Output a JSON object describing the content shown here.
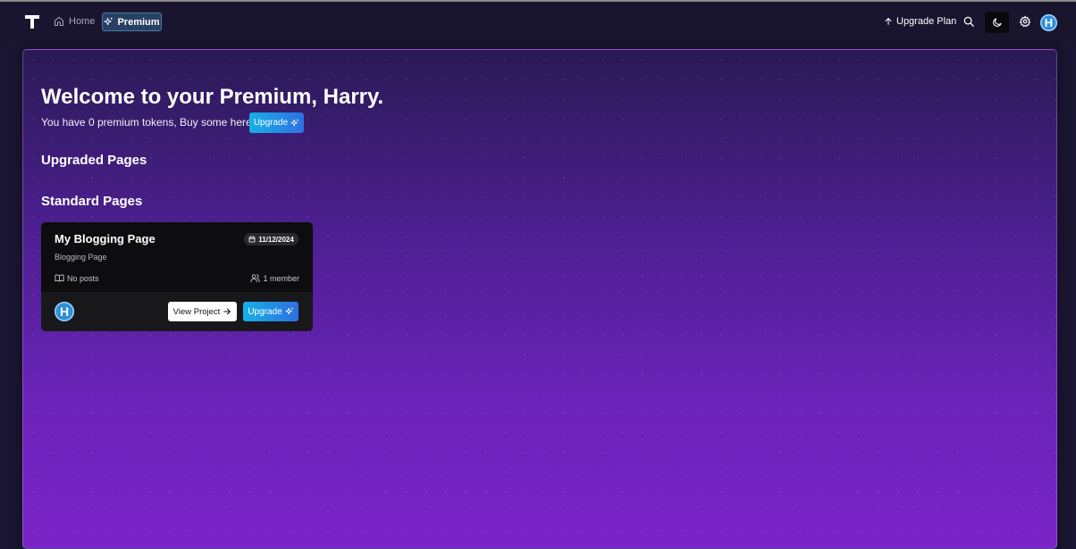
{
  "nav": {
    "home_label": "Home",
    "premium_label": "Premium",
    "upgrade_plan_label": "Upgrade Plan",
    "avatar_letter": "H"
  },
  "main": {
    "welcome": "Welcome to your Premium, Harry.",
    "tokens_text": "You have 0 premium tokens, Buy some here:",
    "upgrade_label": "Upgrade",
    "upgraded_title": "Upgraded Pages",
    "standard_title": "Standard Pages"
  },
  "card": {
    "title": "My Blogging Page",
    "date": "11/12/2024",
    "subtitle": "Blogging Page",
    "posts": "No posts",
    "members": "1 member",
    "avatar_letter": "H",
    "view_label": "View Project",
    "upgrade_label": "Upgrade"
  },
  "colors": {
    "accent_gradient_start": "#16b1e6",
    "accent_gradient_end": "#2f6fe2",
    "background_top": "#19152f",
    "background_bottom": "#7b24c8",
    "card_bg": "#0d0d0f"
  },
  "icons": {
    "logo": "t-logo-icon",
    "home": "home-icon",
    "premium": "sparkles-icon",
    "upgrade_plan": "arrow-up-icon",
    "search": "search-icon",
    "theme": "moon-icon",
    "settings": "gear-icon",
    "calendar": "calendar-icon",
    "posts": "book-icon",
    "members": "users-icon",
    "view": "arrow-right-icon"
  }
}
